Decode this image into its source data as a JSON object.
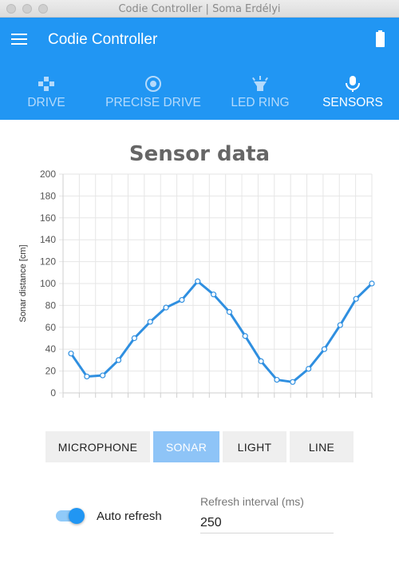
{
  "window": {
    "title": "Codie Controller | Soma Erdélyi"
  },
  "appbar": {
    "title": "Codie Controller",
    "menu_icon": "hamburger-icon",
    "battery_icon": "battery-full-icon",
    "color": "#2196f3"
  },
  "tabs": [
    {
      "label": "DRIVE",
      "icon": "gamepad-icon",
      "active": false
    },
    {
      "label": "PRECISE DRIVE",
      "icon": "target-icon",
      "active": false
    },
    {
      "label": "LED RING",
      "icon": "light-icon",
      "active": false
    },
    {
      "label": "SENSORS",
      "icon": "microphone-icon",
      "active": true
    }
  ],
  "chart_data": {
    "type": "line",
    "title": "Sensor data",
    "xlabel": "",
    "ylabel": "Sonar distance [cm]",
    "ylim": [
      0,
      200
    ],
    "yticks": [
      0,
      20,
      40,
      60,
      80,
      100,
      120,
      140,
      160,
      180,
      200
    ],
    "grid": true,
    "series": [
      {
        "color": "#2f8fe0",
        "values": [
          36,
          15,
          16,
          30,
          50,
          65,
          78,
          85,
          102,
          90,
          74,
          52,
          29,
          12,
          10,
          22,
          40,
          62,
          86,
          100
        ]
      }
    ]
  },
  "sensor_buttons": [
    {
      "label": "MICROPHONE",
      "active": false
    },
    {
      "label": "SONAR",
      "active": true
    },
    {
      "label": "LIGHT",
      "active": false
    },
    {
      "label": "LINE",
      "active": false
    }
  ],
  "auto_refresh": {
    "label": "Auto refresh",
    "enabled": true
  },
  "refresh_interval": {
    "label": "Refresh interval (ms)",
    "value": "250"
  }
}
